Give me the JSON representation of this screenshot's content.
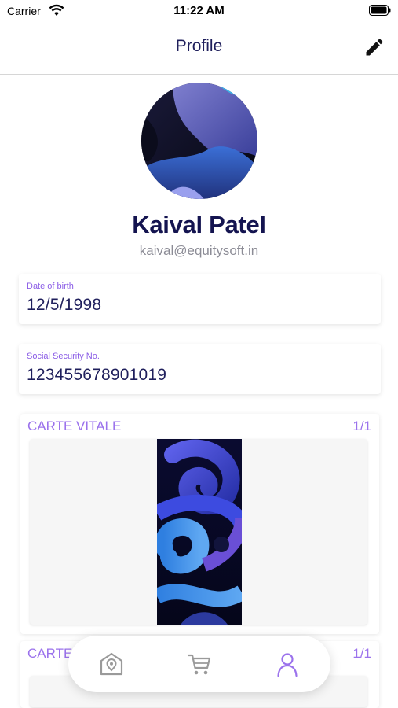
{
  "status_bar": {
    "carrier": "Carrier",
    "time": "11:22 AM"
  },
  "header": {
    "title": "Profile",
    "edit_icon": "pencil-icon"
  },
  "profile": {
    "name": "Kaival Patel",
    "email": "kaival@equitysoft.in"
  },
  "fields": [
    {
      "label": "Date of birth",
      "value": "12/5/1998"
    },
    {
      "label": "Social Security No.",
      "value": "123455678901019"
    }
  ],
  "cards": [
    {
      "title": "CARTE VITALE",
      "count": "1/1"
    },
    {
      "title": "CARTE",
      "count": "1/1"
    }
  ],
  "tab_bar": {
    "tabs": [
      {
        "icon": "home-icon",
        "active": false
      },
      {
        "icon": "cart-icon",
        "active": false
      },
      {
        "icon": "user-icon",
        "active": true
      }
    ]
  },
  "colors": {
    "accent": "#9b72ec",
    "label": "#8a5ce6",
    "text_dark": "#1f1f5c",
    "muted": "#8c8c96"
  }
}
